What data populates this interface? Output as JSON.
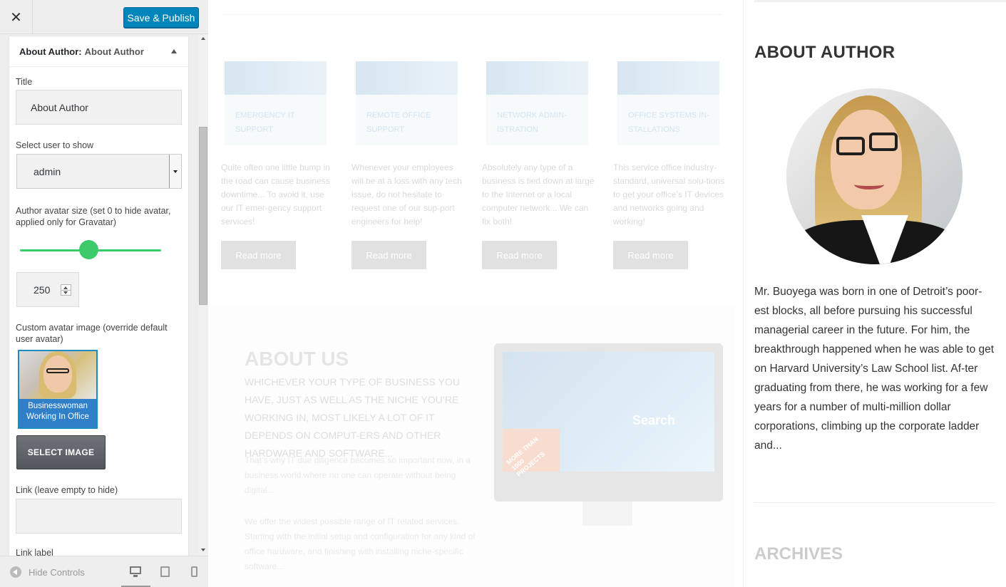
{
  "toolbar": {
    "close_label": "✕",
    "publish_label": "Save & Publish"
  },
  "widget": {
    "title_prefix": "About Author:",
    "title_name": "About Author",
    "fields": {
      "title_label": "Title",
      "title_value": "About Author",
      "user_label": "Select user to show",
      "user_value": "admin",
      "avatar_size_label": "Author avatar size (set 0 to hide avatar, applied only for Gravatar)",
      "avatar_size_value": "250",
      "avatar_size_slider_fraction": 0.45,
      "custom_avatar_label": "Custom avatar image (override default user avatar)",
      "avatar_caption": "Businesswoman Working In Office",
      "select_image_label": "SELECT IMAGE",
      "link_label": "Link (leave empty to hide)",
      "link_value": "",
      "link_text_label": "Link label"
    }
  },
  "footer": {
    "hide_controls_label": "Hide Controls",
    "devices": [
      "desktop-icon",
      "tablet-icon",
      "mobile-icon"
    ]
  },
  "preview": {
    "services": [
      {
        "title": "EMERGENCY IT SUPPORT",
        "desc": "Quite often one little bump in the road can cause business downtime... To avoid it, use our IT emer-gency support services!",
        "button": "Read more"
      },
      {
        "title": "REMOTE OFFICE SUPPORT",
        "desc": "Whenever your employees will be at a loss with any tech issue, do not hesitate to request one of our sup-port engineers for help!",
        "button": "Read more"
      },
      {
        "title": "NETWORK ADMIN-ISTRATION",
        "desc": "Absolutely any type of a business is tied down at large to the Internet or a local computer network... We can fix both!",
        "button": "Read more"
      },
      {
        "title": "OFFICE SYSTEMS IN-STALLATIONS",
        "desc": "This service office industry-standard, universal solu-tions to get your office’s IT devices and networks going and working!",
        "button": "Read more"
      }
    ],
    "about_us": {
      "title": "ABOUT US",
      "lead": "WHICHEVER YOUR TYPE OF BUSINESS YOU HAVE, JUST AS WELL AS THE NICHE YOU’RE WORKING IN, MOST LIKELY A LOT OF IT DEPENDS ON COMPUT-ERS AND OTHER HARDWARE AND SOFTWARE...",
      "para1": "That’s why IT due diligence becomes so important now, in a business world where no one can operate without being digital...",
      "para2": "We offer the widest possible range of IT related services. Starting with the initial setup and configuration for any kind of office hardware, and finishing with installing niche-specific software..."
    },
    "monitor_screen_text": "Search",
    "monitor_ribbon_text": "MORE THAN 1000 PROJECTS"
  },
  "sidebar": {
    "about_heading": "ABOUT AUTHOR",
    "bio": "Mr. Buoyega was born in one of Detroit’s poor-est blocks, all before pursuing his successful managerial career in the future. For him, the breakthrough happened when he was able to get on Harvard University’s Law School list. Af-ter graduating from there, he was working for a few years for a number of multi-million dollar corporations, climbing up the corporate ladder and...",
    "archives_heading": "ARCHIVES"
  },
  "colors": {
    "publish_blue": "#0085ba",
    "slider_green": "#3dca6b",
    "heading_dark": "#333333"
  }
}
